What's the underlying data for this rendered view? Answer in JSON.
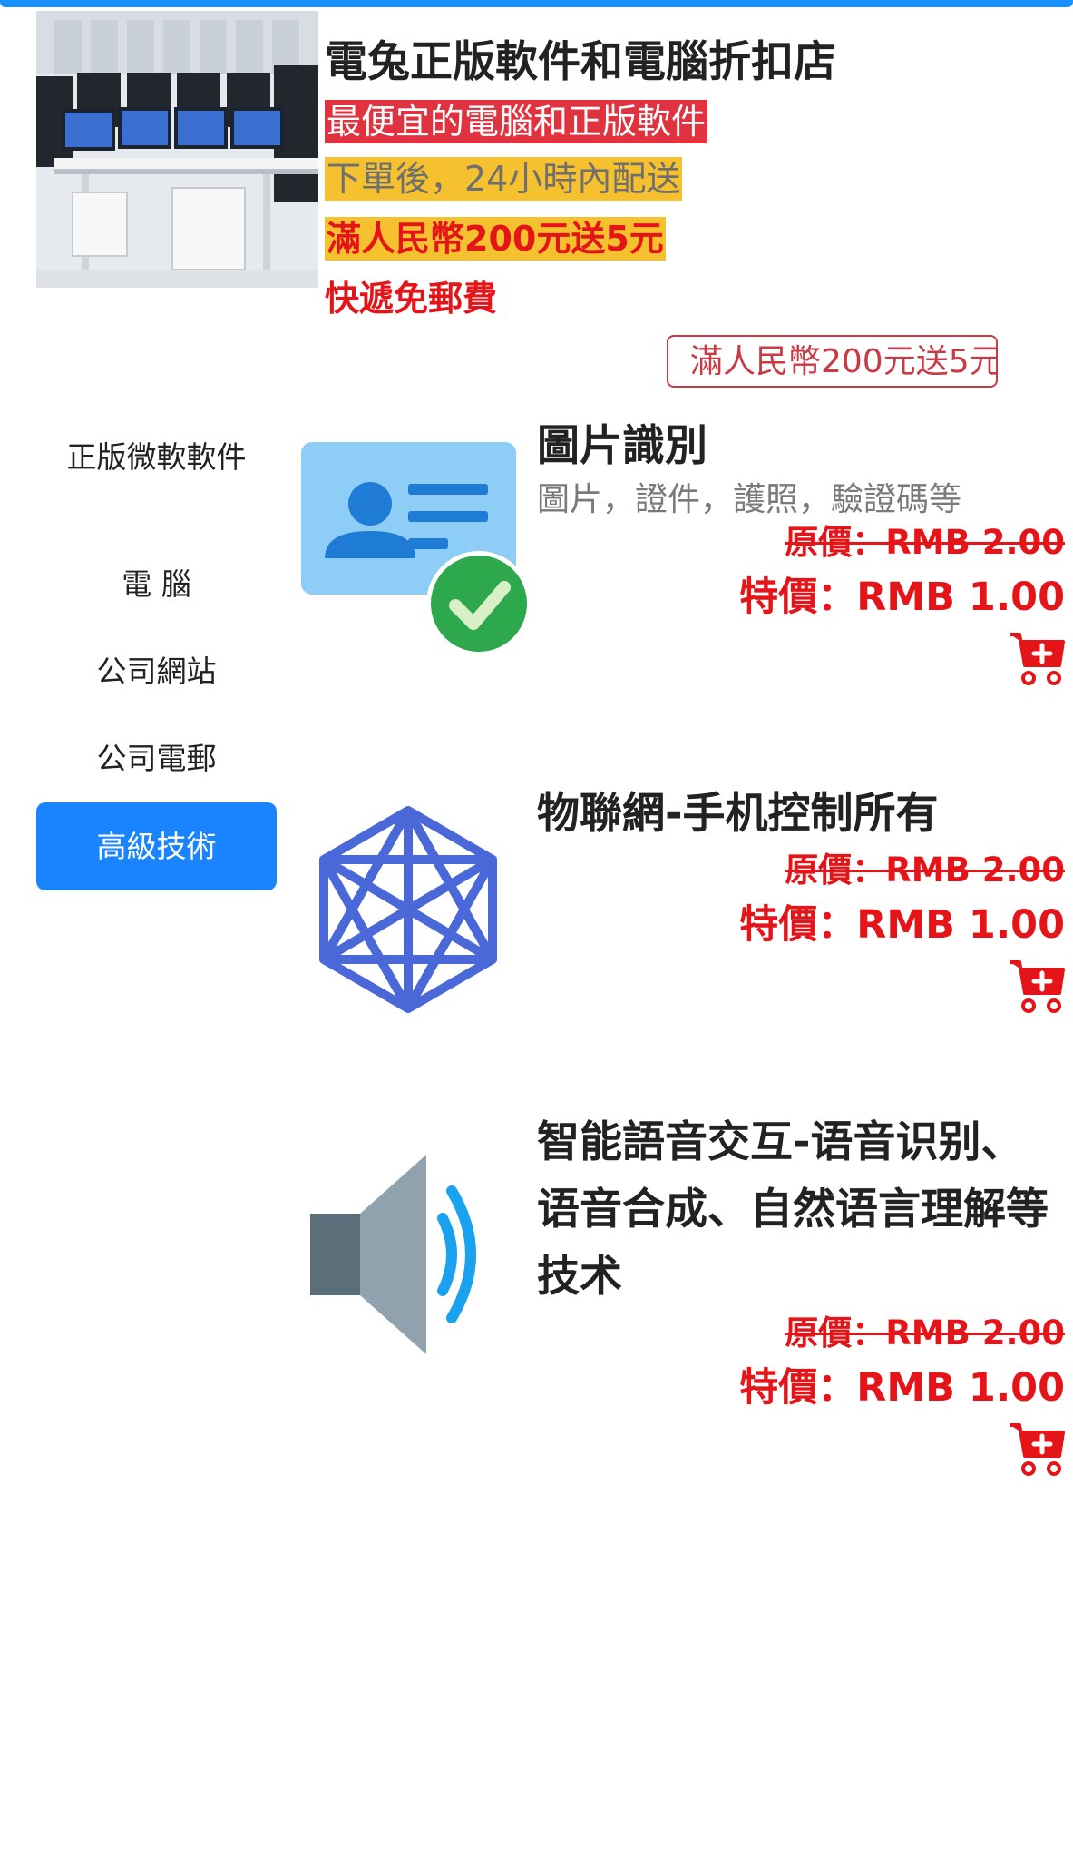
{
  "store": {
    "title": "電兔正版軟件和電腦折扣店",
    "tagline": "最便宜的電腦和正版軟件",
    "delivery": "下單後，24小時內配送",
    "promo_highlight": "滿人民幣200元送5元",
    "free_shipping": "快遞免郵費",
    "promo_badge": "滿人民幣200元送5元"
  },
  "sidebar": {
    "items": [
      {
        "label": "正版微軟軟件",
        "active": false
      },
      {
        "label": "電 腦",
        "active": false
      },
      {
        "label": "公司網站",
        "active": false
      },
      {
        "label": "公司電郵",
        "active": false
      },
      {
        "label": "高級技術",
        "active": true
      }
    ]
  },
  "products": [
    {
      "name": "圖片識別",
      "description": "圖片，證件，護照，驗證碼等",
      "price_original": "原價：RMB 2.00",
      "price_sale": "特價：RMB 1.00",
      "icon": "id-card-check-icon"
    },
    {
      "name": "物聯網-手机控制所有",
      "description": "",
      "price_original": "原價：RMB 2.00",
      "price_sale": "特價：RMB 1.00",
      "icon": "iot-hexagon-icon"
    },
    {
      "name": "智能語音交互-语音识别、语音合成、自然语言理解等技术",
      "description": "",
      "price_original": "原價：RMB 2.00",
      "price_sale": "特價：RMB 1.00",
      "icon": "speaker-icon"
    }
  ],
  "colors": {
    "accent": "#1a84ff",
    "price_red": "#e41419",
    "highlight_red": "#e0323f",
    "highlight_yellow": "#f6c12e"
  }
}
